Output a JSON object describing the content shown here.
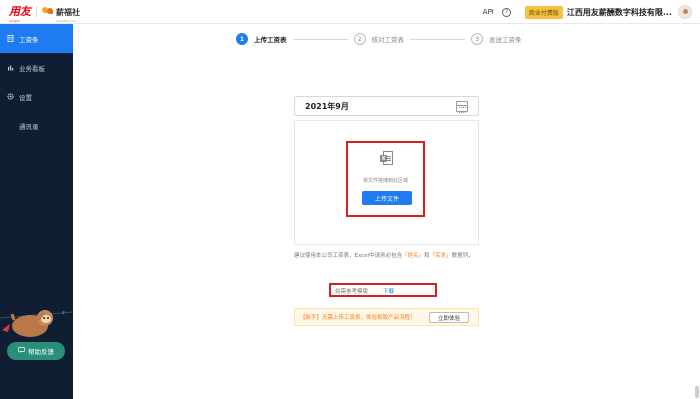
{
  "header": {
    "logo_primary": "用友",
    "logo_primary_sub": "yonyou",
    "logo_secondary": "薪福社",
    "logo_secondary_sub": "xinfushe.com",
    "api_label": "API",
    "help_icon": "?",
    "badge_label": "商业付费版",
    "company_name": "江西用友薪酬数字科技有限..."
  },
  "sidebar": {
    "items": [
      {
        "label": "工资条",
        "icon": "doc-icon",
        "active": true
      },
      {
        "label": "业务看板",
        "icon": "chart-icon",
        "active": false
      },
      {
        "label": "设置",
        "icon": "gear-icon",
        "active": false
      },
      {
        "label": "通讯录",
        "icon": "",
        "active": false
      }
    ],
    "help_button": "帮助反馈"
  },
  "steps": [
    {
      "num": "1",
      "label": "上传工资表",
      "active": true
    },
    {
      "num": "2",
      "label": "核对工资表",
      "active": false
    },
    {
      "num": "3",
      "label": "发送工资条",
      "active": false
    }
  ],
  "upload": {
    "month": "2021年9月",
    "file_icon_letter": "X",
    "drag_text": "将文件拖拽到此区域",
    "upload_button": "上传文件"
  },
  "tip": {
    "prefix": "建议使用本公司工资表，Excel中请务必包含",
    "field1": "「姓名」",
    "mid": "和",
    "field2": "「实发」",
    "suffix": "数据列，",
    "template_text": "如需参考模版",
    "download_link": "下载"
  },
  "banner": {
    "text": "【新手】无需上传工资表，体验极致产品流程！",
    "button": "立即体验"
  },
  "colors": {
    "accent": "#1f7cf0",
    "sidebar_bg": "#0f1e33",
    "highlight": "#ff7a1a",
    "annotation_red": "#d42020"
  }
}
